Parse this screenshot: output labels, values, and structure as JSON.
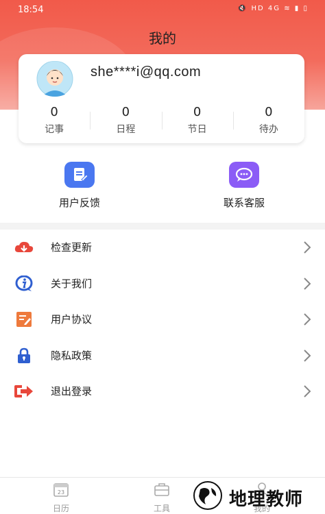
{
  "status_bar": {
    "time": "18:54",
    "indicators": "HD  4G"
  },
  "page": {
    "title": "我的"
  },
  "profile": {
    "email": "she****i@qq.com",
    "stats": [
      {
        "value": "0",
        "label": "记事"
      },
      {
        "value": "0",
        "label": "日程"
      },
      {
        "value": "0",
        "label": "节日"
      },
      {
        "value": "0",
        "label": "待办"
      }
    ]
  },
  "quick_actions": [
    {
      "label": "用户反馈",
      "icon": "feedback-icon",
      "color": "#4a77f0"
    },
    {
      "label": "联系客服",
      "icon": "customer-service-icon",
      "color": "#8b5cf6"
    }
  ],
  "menu": [
    {
      "label": "检查更新",
      "icon": "cloud-download-icon",
      "color": "#e8473b"
    },
    {
      "label": "关于我们",
      "icon": "info-bubble-icon",
      "color": "#2f5fd0"
    },
    {
      "label": "用户协议",
      "icon": "document-edit-icon",
      "color": "#ee7a3c"
    },
    {
      "label": "隐私政策",
      "icon": "lock-icon",
      "color": "#2f5fd0"
    },
    {
      "label": "退出登录",
      "icon": "logout-icon",
      "color": "#e8473b"
    }
  ],
  "tabbar": [
    {
      "label": "日历",
      "icon": "calendar-icon",
      "calendar_day": "23"
    },
    {
      "label": "工具",
      "icon": "toolbox-icon"
    },
    {
      "label": "我的",
      "icon": "user-icon"
    }
  ],
  "watermark": {
    "text": "地理教师"
  },
  "colors": {
    "header_red": "#f15a4a",
    "divider": "#f3f3f3",
    "tab_inactive": "#999999"
  }
}
